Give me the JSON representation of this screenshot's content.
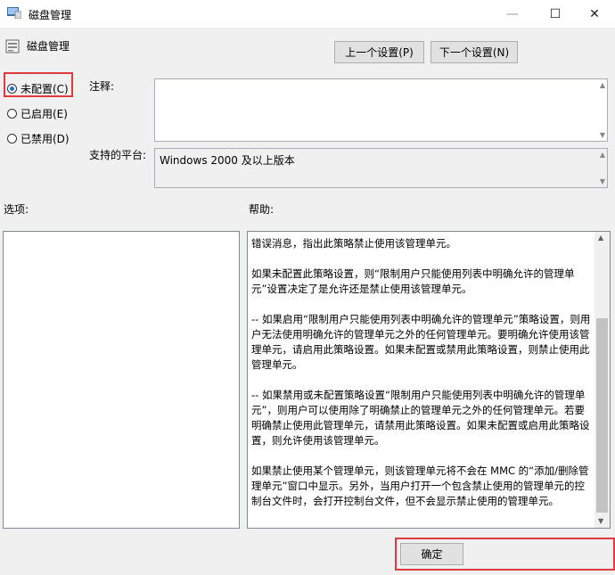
{
  "window": {
    "title": "磁盘管理",
    "controls": {
      "minimize": "—",
      "maximize": "☐",
      "close": "✕"
    }
  },
  "header": {
    "policy_title": "磁盘管理",
    "prev_setting": "上一个设置(P)",
    "next_setting": "下一个设置(N)"
  },
  "state_options": [
    {
      "label": "未配置(C)",
      "selected": true
    },
    {
      "label": "已启用(E)",
      "selected": false
    },
    {
      "label": "已禁用(D)",
      "selected": false
    }
  ],
  "comment": {
    "label": "注释:",
    "value": ""
  },
  "platform": {
    "label": "支持的平台:",
    "value": "Windows 2000 及以上版本"
  },
  "options": {
    "label": "选项:"
  },
  "help": {
    "label": "帮助:",
    "paragraphs": [
      "错误消息，指出此策略禁止使用该管理单元。",
      "如果未配置此策略设置，则“限制用户只能使用列表中明确允许的管理单元”设置决定了是允许还是禁止使用该管理单元。",
      "-- 如果启用“限制用户只能使用列表中明确允许的管理单元”策略设置，则用户无法使用明确允许的管理单元之外的任何管理单元。要明确允许使用该管理单元，请启用此策略设置。如果未配置或禁用此策略设置，则禁止使用此管理单元。",
      "-- 如果禁用或未配置策略设置“限制用户只能使用列表中明确允许的管理单元”，则用户可以使用除了明确禁止的管理单元之外的任何管理单元。若要明确禁止使用此管理单元，请禁用此策略设置。如果未配置或启用此策略设置，则允许使用该管理单元。",
      "如果禁止使用某个管理单元，则该管理单元将不会在 MMC 的“添加/删除管理单元”窗口中显示。另外，当用户打开一个包含禁止使用的管理单元的控制台文件时，会打开控制台文件，但不会显示禁止使用的管理单元。"
    ]
  },
  "footer": {
    "ok": "确定"
  },
  "icons": {
    "app": "group-policy-icon",
    "policy": "policy-setting-icon"
  },
  "colors": {
    "highlight": "#e0393e",
    "radio_dot": "#1a73c9"
  }
}
